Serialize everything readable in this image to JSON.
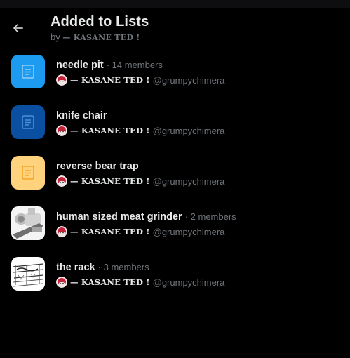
{
  "header": {
    "title": "Added to Lists",
    "subtitle_prefix": "by",
    "subtitle_name": "— KASANE TED !"
  },
  "lists": [
    {
      "name": "needle pit",
      "members": "· 14 members",
      "owner_name": "— KASANE TED !",
      "owner_handle": "@grumpychimera",
      "icon": "list-doc-icon",
      "color": "#1d9bf0"
    },
    {
      "name": "knife chair",
      "members": "",
      "owner_name": "— KASANE TED !",
      "owner_handle": "@grumpychimera",
      "icon": "list-doc-icon",
      "color": "#0a4fa0"
    },
    {
      "name": "reverse bear trap",
      "members": "",
      "owner_name": "— KASANE TED !",
      "owner_handle": "@grumpychimera",
      "icon": "list-doc-icon",
      "color": "#ffd27d"
    },
    {
      "name": "human sized meat grinder",
      "members": "· 2 members",
      "owner_name": "— KASANE TED !",
      "owner_handle": "@grumpychimera",
      "icon": "grinder-photo",
      "color": "#dddddd"
    },
    {
      "name": "the rack",
      "members": "· 3 members",
      "owner_name": "— KASANE TED !",
      "owner_handle": "@grumpychimera",
      "icon": "rack-sketch",
      "color": "#ffffff"
    }
  ]
}
